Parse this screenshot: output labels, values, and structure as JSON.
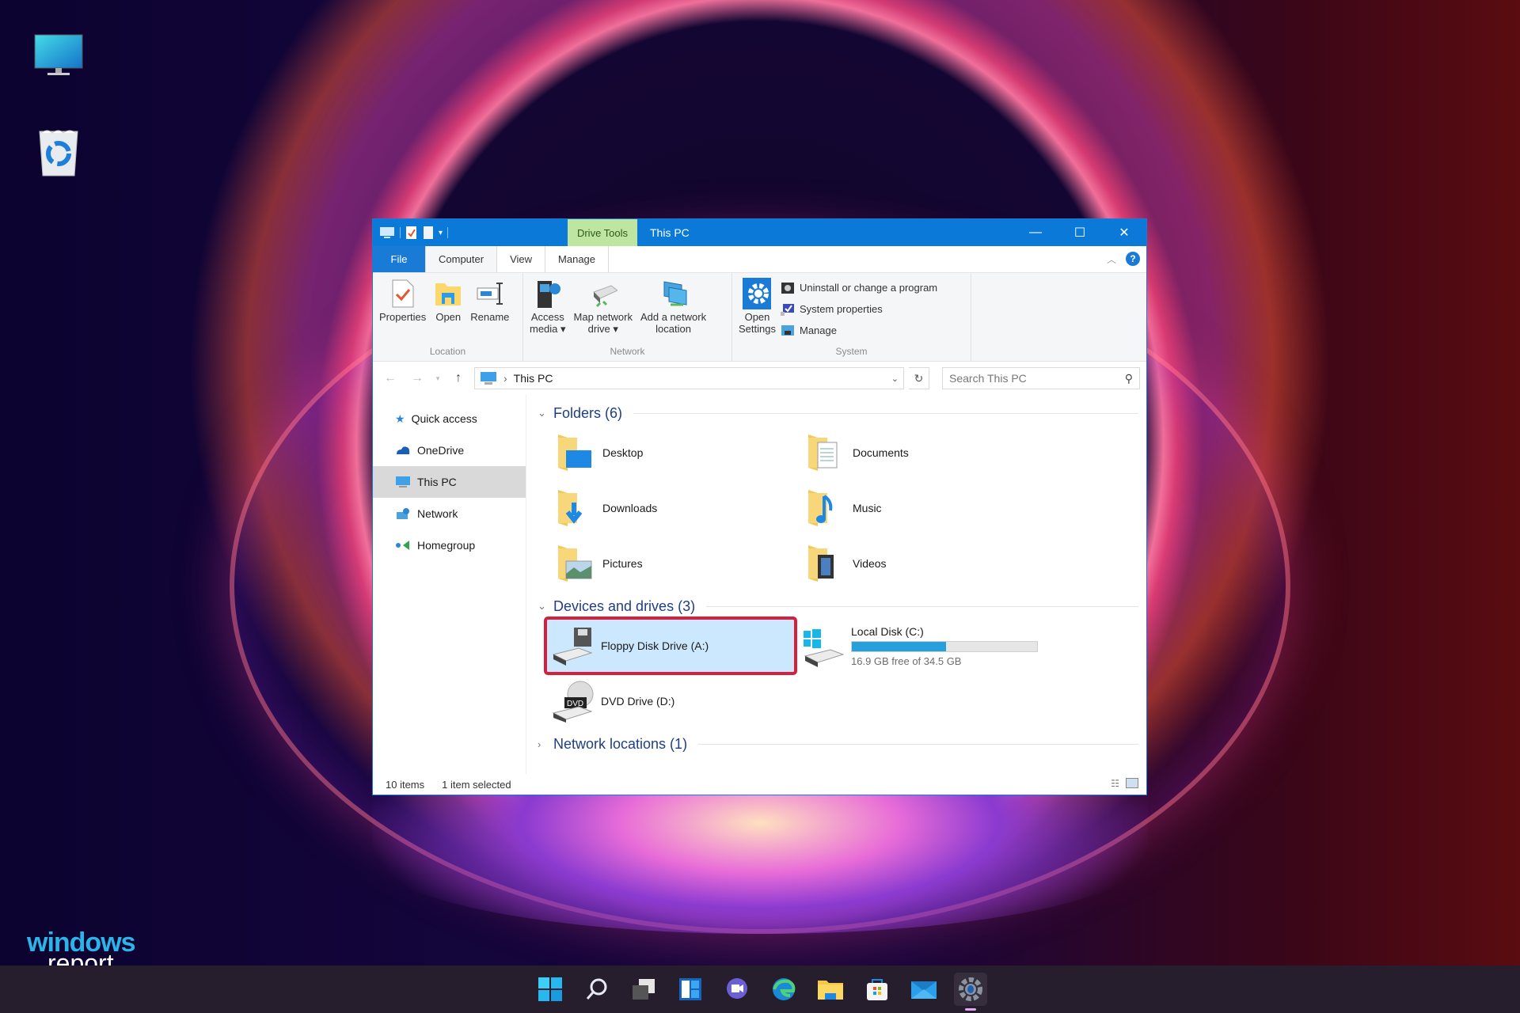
{
  "desktop": {
    "icons": [
      {
        "name": "This PC",
        "icon": "monitor-icon"
      },
      {
        "name": "Recycle Bin",
        "icon": "recycle-bin-icon"
      }
    ],
    "brand": {
      "line1": "windows",
      "line2": "report"
    }
  },
  "window": {
    "title": "This PC",
    "contextual_tab_group": "Drive Tools",
    "controls": {
      "minimize": "—",
      "maximize": "☐",
      "close": "✕"
    },
    "ribbon_tabs": [
      {
        "label": "File",
        "active": false
      },
      {
        "label": "Computer",
        "active": true
      },
      {
        "label": "View",
        "active": false
      },
      {
        "label": "Manage",
        "active": false
      }
    ],
    "ribbon": {
      "groups": [
        {
          "label": "Location",
          "buttons": [
            {
              "label": "Properties",
              "icon": "properties-icon"
            },
            {
              "label": "Open",
              "icon": "open-folder-icon"
            },
            {
              "label": "Rename",
              "icon": "rename-icon"
            }
          ]
        },
        {
          "label": "Network",
          "buttons": [
            {
              "label": "Access\nmedia ▾",
              "line1": "Access",
              "line2": "media ▾",
              "icon": "media-server-icon"
            },
            {
              "line1": "Map network",
              "line2": "drive ▾",
              "icon": "network-drive-icon"
            },
            {
              "line1": "Add a network",
              "line2": "location",
              "icon": "network-location-icon"
            }
          ]
        },
        {
          "label": "System",
          "buttons": [
            {
              "line1": "Open",
              "line2": "Settings",
              "icon": "settings-gear-icon"
            }
          ],
          "small_buttons": [
            {
              "label": "Uninstall or change a program",
              "icon": "uninstall-icon"
            },
            {
              "label": "System properties",
              "icon": "system-properties-icon"
            },
            {
              "label": "Manage",
              "icon": "manage-icon"
            }
          ]
        }
      ]
    },
    "address": {
      "path": "This PC",
      "search_placeholder": "Search This PC"
    },
    "nav_pane": [
      {
        "label": "Quick access",
        "icon": "star-icon",
        "selected": false
      },
      {
        "label": "OneDrive",
        "icon": "cloud-icon",
        "selected": false
      },
      {
        "label": "This PC",
        "icon": "monitor-icon",
        "selected": true
      },
      {
        "label": "Network",
        "icon": "network-icon",
        "selected": false
      },
      {
        "label": "Homegroup",
        "icon": "homegroup-icon",
        "selected": false
      }
    ],
    "sections": {
      "folders": {
        "title": "Folders (6)",
        "expanded": true,
        "items": [
          {
            "label": "Desktop",
            "icon": "desktop-folder-icon"
          },
          {
            "label": "Documents",
            "icon": "documents-folder-icon"
          },
          {
            "label": "Downloads",
            "icon": "downloads-folder-icon"
          },
          {
            "label": "Music",
            "icon": "music-folder-icon"
          },
          {
            "label": "Pictures",
            "icon": "pictures-folder-icon"
          },
          {
            "label": "Videos",
            "icon": "videos-folder-icon"
          }
        ]
      },
      "devices": {
        "title": "Devices and drives (3)",
        "expanded": true,
        "items": [
          {
            "label": "Floppy Disk Drive (A:)",
            "icon": "floppy-drive-icon",
            "selected": true
          },
          {
            "label": "Local Disk (C:)",
            "icon": "windows-drive-icon",
            "free_text": "16.9 GB free of 34.5 GB",
            "used_fraction": 0.51
          },
          {
            "label": "DVD Drive (D:)",
            "icon": "dvd-drive-icon"
          }
        ]
      },
      "network_locations": {
        "title": "Network locations (1)",
        "expanded": false
      }
    },
    "status": {
      "item_count": "10 items",
      "selection": "1 item selected"
    }
  },
  "taskbar": {
    "items": [
      {
        "name": "Start",
        "icon": "windows-start-icon"
      },
      {
        "name": "Search",
        "icon": "search-icon"
      },
      {
        "name": "Task View",
        "icon": "task-view-icon"
      },
      {
        "name": "Widgets",
        "icon": "widgets-icon"
      },
      {
        "name": "Chat",
        "icon": "chat-icon"
      },
      {
        "name": "Microsoft Edge",
        "icon": "edge-icon"
      },
      {
        "name": "File Explorer",
        "icon": "file-explorer-icon"
      },
      {
        "name": "Microsoft Store",
        "icon": "store-icon"
      },
      {
        "name": "Mail",
        "icon": "mail-icon"
      },
      {
        "name": "Settings",
        "icon": "settings-icon",
        "active": true
      }
    ]
  },
  "colors": {
    "title_bar": "#0a79d8",
    "drive_tools": "#bfe6a0",
    "selection_fill": "#cce8ff",
    "highlight_outline": "#d61f3d",
    "usage_bar": "#26a0da",
    "section_heading": "#1f3d87"
  }
}
